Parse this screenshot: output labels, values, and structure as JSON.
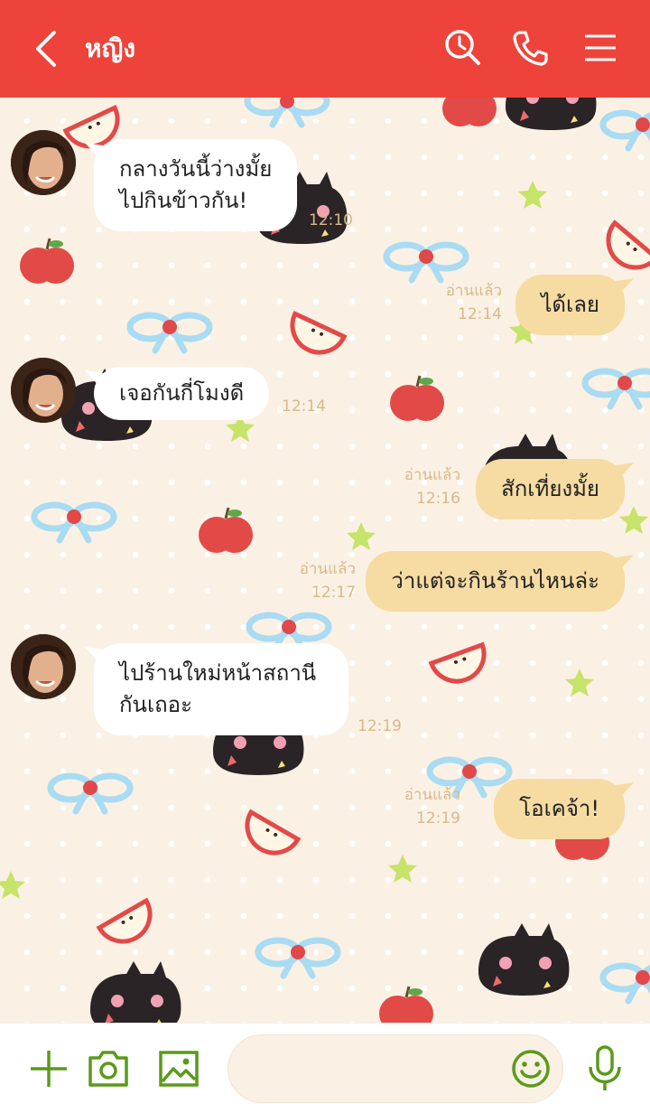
{
  "header": {
    "title": "หญิง",
    "color": "#ee433a",
    "icons": [
      "back-chevron-icon",
      "search-clock-icon",
      "phone-icon",
      "menu-icon"
    ]
  },
  "messages": [
    {
      "direction": "in",
      "lines": [
        "กลางวันนี้ว่างมั้ย",
        "ไปกินข้าวกัน!"
      ],
      "time": "12:10"
    },
    {
      "direction": "out",
      "text": "ได้เลย",
      "read": "อ่านแล้ว",
      "time": "12:14"
    },
    {
      "direction": "in",
      "lines": [
        "เจอกันกี่โมงดี"
      ],
      "time": "12:14"
    },
    {
      "direction": "out",
      "text": "สักเที่ยงมั้ย",
      "read": "อ่านแล้ว",
      "time": "12:16"
    },
    {
      "direction": "out",
      "text": "ว่าแต่จะกินร้านไหนล่ะ",
      "read": "อ่านแล้ว",
      "time": "12:17"
    },
    {
      "direction": "in",
      "lines": [
        "ไปร้านใหม่หน้าสถานี",
        "กันเถอะ"
      ],
      "time": "12:19"
    },
    {
      "direction": "out",
      "text": "โอเคจ้า!",
      "read": "อ่านแล้ว",
      "time": "12:19"
    }
  ],
  "composer": {
    "placeholder": "",
    "icons": [
      "plus-icon",
      "camera-icon",
      "image-icon",
      "emoji-icon",
      "mic-icon"
    ],
    "accent": "#5a9a1a"
  },
  "colors": {
    "incoming_bubble": "#ffffff",
    "outgoing_bubble": "#f6dca3",
    "background": "#faf1e4"
  }
}
